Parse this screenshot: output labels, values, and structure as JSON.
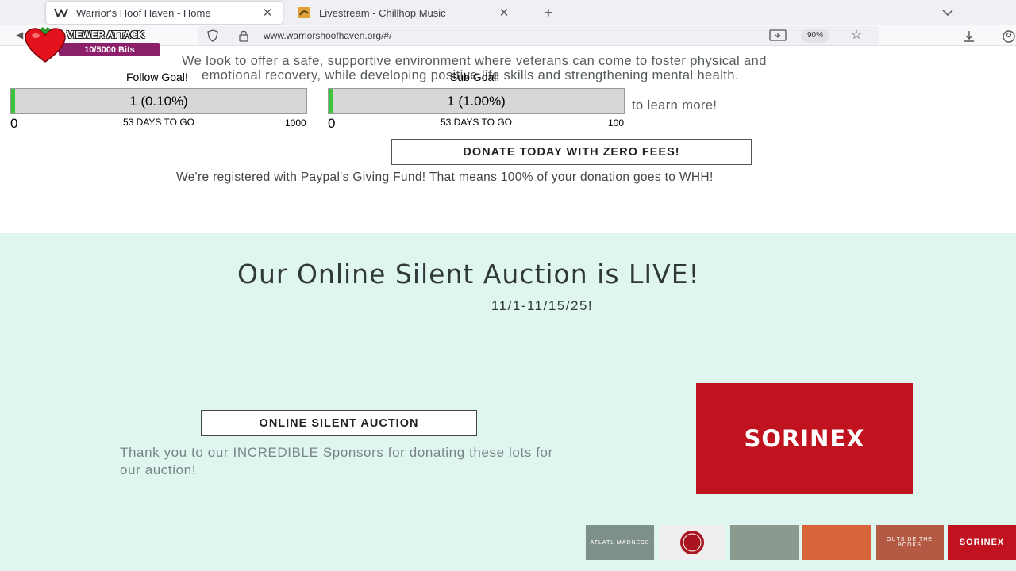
{
  "browser": {
    "tabs": [
      {
        "title": "Warrior's Hoof Haven - Home",
        "icon": "wix-w-icon",
        "active": true
      },
      {
        "title": "Livestream - Chillhop Music",
        "icon": "chillhop-icon",
        "active": false
      }
    ],
    "url": "www.warriorshoofhaven.org/#/",
    "zoom": "90%"
  },
  "overlay": {
    "viewer_attack": {
      "title": "VIEWER ATTACK",
      "bits": "10/5000 Bits"
    },
    "follow_goal": {
      "label": "Follow Goal!",
      "value": "1 (0.10%)",
      "progress_fraction": 0.001,
      "min": "0",
      "days": "53 DAYS TO GO",
      "max": "1000"
    },
    "sub_goal": {
      "label": "Sub Goal!",
      "value": "1 (1.00%)",
      "progress_fraction": 0.01,
      "min": "0",
      "days": "53 DAYS TO GO",
      "max": "100"
    }
  },
  "page": {
    "mission_line1": "We look to offer a safe, supportive environment where veterans can come to foster physical and",
    "mission_line2": "emotional recovery, while developing positive life skills and strengthening mental health.",
    "learn_more_fragment": "to learn more!",
    "donate_button": "DONATE TODAY WITH ZERO FEES!",
    "paypal_note": "We're registered with Paypal's Giving Fund! That means 100% of your donation goes to WHH!",
    "auction": {
      "heading": "Our Online Silent Auction is LIVE!",
      "dates": "11/1-11/15/25!",
      "button": "ONLINE SILENT AUCTION",
      "thanks_pre": "Thank you to our ",
      "thanks_link": "INCREDIBLE ",
      "thanks_post": "Sponsors for donating these lots for our auction!",
      "sponsor_logo": "SORINEX",
      "thumbnails": [
        {
          "label": "ATLATL MADNESS",
          "color": "#7e908a"
        },
        {
          "label": "",
          "color": "#efefef"
        },
        {
          "label": "",
          "color": "#8a9a8e"
        },
        {
          "label": "",
          "color": "#d8643a"
        },
        {
          "label": "OUTSIDE THE BOOKS",
          "color": "#b45a44"
        },
        {
          "label": "SORINEX",
          "color": "#c1121f"
        }
      ]
    }
  }
}
